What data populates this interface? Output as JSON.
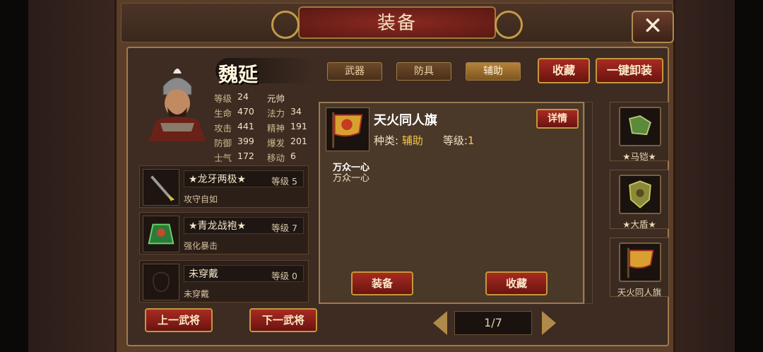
{
  "window": {
    "title": "装备",
    "close_label": "✕"
  },
  "hero": {
    "name": "魏延",
    "stats": [
      [
        {
          "label": "等级",
          "value": "24"
        },
        {
          "label": "",
          "value": "元帅"
        }
      ],
      [
        {
          "label": "生命",
          "value": "470"
        },
        {
          "label": "法力",
          "value": "34"
        }
      ],
      [
        {
          "label": "攻击",
          "value": "441"
        },
        {
          "label": "精神",
          "value": "191"
        }
      ],
      [
        {
          "label": "防御",
          "value": "399"
        },
        {
          "label": "爆发",
          "value": "201"
        }
      ],
      [
        {
          "label": "士气",
          "value": "172"
        },
        {
          "label": "移动",
          "value": "6"
        }
      ]
    ]
  },
  "gear": [
    {
      "name": "★龙牙两极★",
      "level": "等级 5",
      "desc": "攻守自如"
    },
    {
      "name": "★青龙战袍★",
      "level": "等级 7",
      "desc": "强化暴击"
    },
    {
      "name": "未穿戴",
      "level": "等级 0",
      "desc": "未穿戴"
    }
  ],
  "nav": {
    "prev": "上一武将",
    "next": "下一武将"
  },
  "tabs": [
    "武器",
    "防具",
    "辅助"
  ],
  "actions": {
    "favorite": "收藏",
    "unequip_all": "一键卸装"
  },
  "detail": {
    "name": "天火同人旗",
    "type_label": "种类:",
    "type_value": "辅助",
    "level_label": "等级:",
    "level_value": "1",
    "details_btn": "详情",
    "effect_title": "万众一心",
    "effect_desc": "万众一心",
    "equip_btn": "装备",
    "favorite_btn": "收藏"
  },
  "pager": {
    "text": "1/7"
  },
  "slots": [
    {
      "label": "★马铠★"
    },
    {
      "label": "★大盾★"
    },
    {
      "label": "天火同人旗"
    }
  ],
  "colors": {
    "accent_red": "#a82a22",
    "gold_border": "#c4973c",
    "highlight_text": "#f4c84a"
  }
}
